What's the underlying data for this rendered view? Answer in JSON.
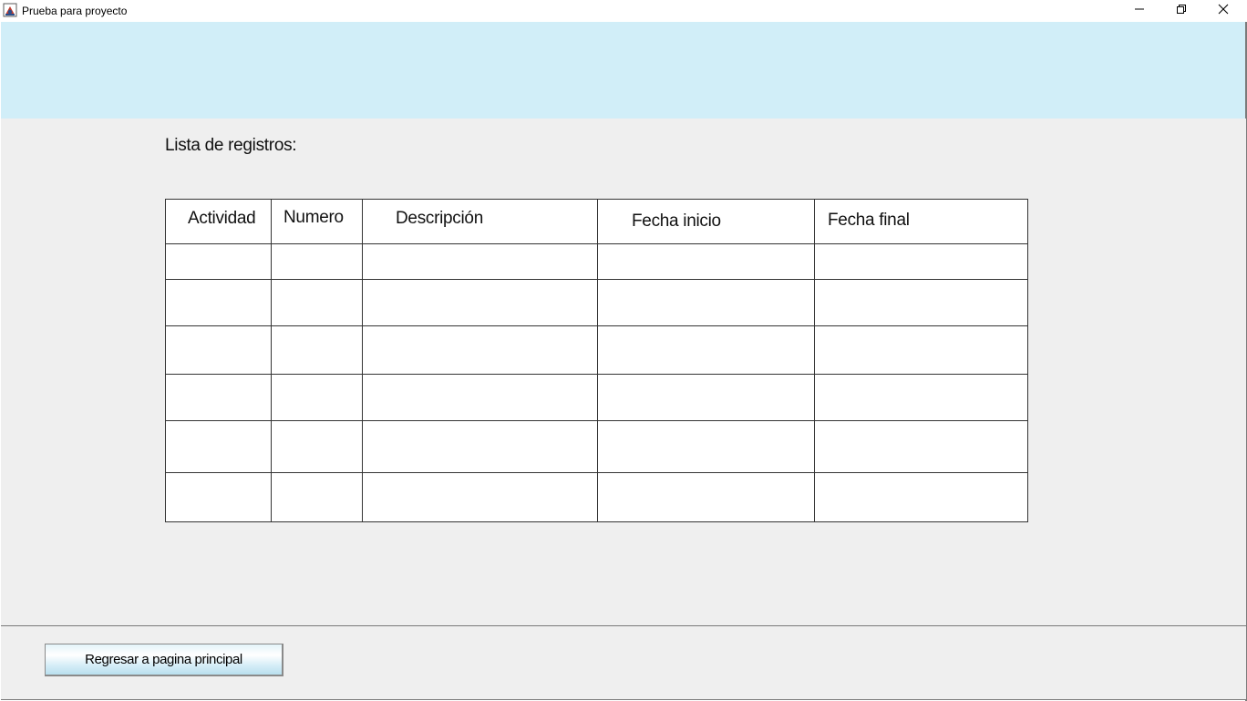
{
  "window": {
    "title": "Prueba para proyecto",
    "icons": [
      "java-app-icon",
      "minimize-icon",
      "restore-icon",
      "close-icon"
    ]
  },
  "banner": {
    "color": "#d1eef8"
  },
  "main": {
    "list_label": "Lista de registros:",
    "table": {
      "columns": [
        "Actividad",
        "Numero",
        "Descripción",
        "Fecha inicio",
        "Fecha final"
      ],
      "rows": [
        [
          "",
          "",
          "",
          "",
          ""
        ],
        [
          "",
          "",
          "",
          "",
          ""
        ],
        [
          "",
          "",
          "",
          "",
          ""
        ],
        [
          "",
          "",
          "",
          "",
          ""
        ],
        [
          "",
          "",
          "",
          "",
          ""
        ],
        [
          "",
          "",
          "",
          "",
          ""
        ]
      ]
    }
  },
  "footer": {
    "back_button_label": "Regresar a pagina principal"
  }
}
